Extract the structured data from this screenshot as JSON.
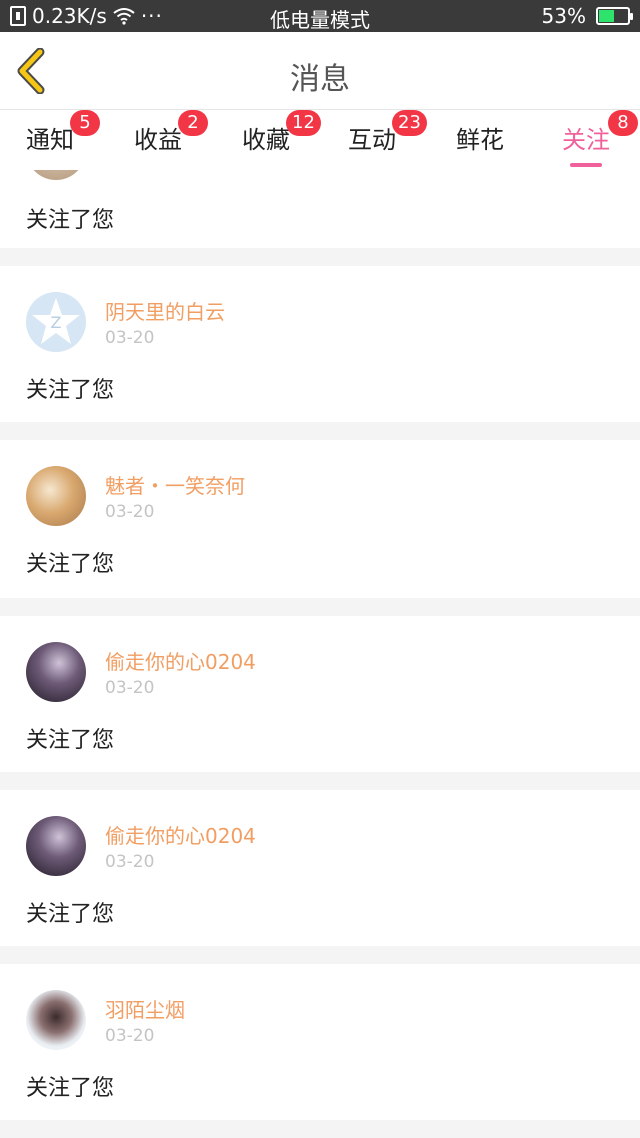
{
  "status_bar": {
    "speed": "0.23K/s",
    "more": "···",
    "mode": "低电量模式",
    "battery": "53%",
    "battery_level": 0.53,
    "battery_color": "#2ee36b"
  },
  "header": {
    "title": "消息",
    "accent": "#f5c614"
  },
  "tabs": [
    {
      "label": "通知",
      "badge": "5"
    },
    {
      "label": "收益",
      "badge": "2"
    },
    {
      "label": "收藏",
      "badge": "12"
    },
    {
      "label": "互动",
      "badge": "23"
    },
    {
      "label": "鲜花",
      "badge": ""
    },
    {
      "label": "关注",
      "badge": "8",
      "active": true
    }
  ],
  "colors": {
    "active_tab": "#f0609a",
    "badge": "#f23645",
    "username": "#f19e63",
    "date": "#c4c4c4"
  },
  "partial_item": {
    "message": "关注了您"
  },
  "items": [
    {
      "name": "阴天里的白云",
      "date": "03-20",
      "message": "关注了您",
      "avatar": "default-avatar-icon"
    },
    {
      "name": "魅者・一笑奈何",
      "date": "03-20",
      "message": "关注了您",
      "avatar": "user-avatar"
    },
    {
      "name": "偷走你的心0204",
      "date": "03-20",
      "message": "关注了您",
      "avatar": "user-avatar"
    },
    {
      "name": "偷走你的心0204",
      "date": "03-20",
      "message": "关注了您",
      "avatar": "user-avatar"
    },
    {
      "name": "羽陌尘烟",
      "date": "03-20",
      "message": "关注了您",
      "avatar": "user-avatar"
    }
  ]
}
